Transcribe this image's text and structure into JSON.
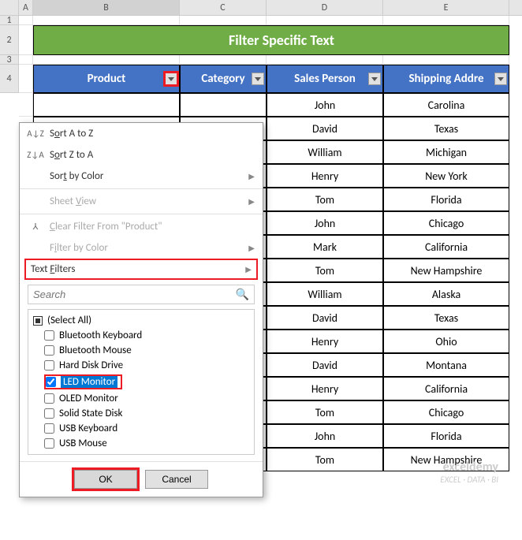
{
  "columns": [
    "A",
    "B",
    "C",
    "D",
    "E"
  ],
  "row_numbers": [
    "1",
    "2",
    "3",
    "4"
  ],
  "title": "Filter Specific Text",
  "headers": {
    "product": "Product",
    "category": "Category",
    "sales_person": "Sales Person",
    "shipping_address": "Shipping Addre"
  },
  "data_rows": [
    {
      "sales_person": "John",
      "shipping_address": "Carolina"
    },
    {
      "sales_person": "David",
      "shipping_address": "Texas"
    },
    {
      "sales_person": "William",
      "shipping_address": "Michigan"
    },
    {
      "sales_person": "Henry",
      "shipping_address": "New York"
    },
    {
      "sales_person": "Tom",
      "shipping_address": "Florida"
    },
    {
      "sales_person": "John",
      "shipping_address": "Chicago"
    },
    {
      "sales_person": "Mark",
      "shipping_address": "California"
    },
    {
      "sales_person": "Tom",
      "shipping_address": "New Hampshire"
    },
    {
      "sales_person": "William",
      "shipping_address": "Alaska"
    },
    {
      "sales_person": "David",
      "shipping_address": "Texas"
    },
    {
      "sales_person": "Henry",
      "shipping_address": "Ohio"
    },
    {
      "sales_person": "David",
      "shipping_address": "Montana"
    },
    {
      "sales_person": "Henry",
      "shipping_address": "California"
    },
    {
      "sales_person": "Tom",
      "shipping_address": "Chicago"
    },
    {
      "sales_person": "John",
      "shipping_address": "Florida"
    },
    {
      "sales_person": "Tom",
      "shipping_address": "New Hampshire"
    }
  ],
  "filter_menu": {
    "sort_az": "Sort A to Z",
    "sort_za": "Sort Z to A",
    "sort_by_color": "Sort by Color",
    "sheet_view": "Sheet View",
    "clear_filter": "Clear Filter From \"Product\"",
    "filter_by_color": "Filter by Color",
    "text_filters": "Text Filters",
    "search_placeholder": "Search",
    "items": {
      "select_all": "(Select All)",
      "bluetooth_keyboard": "Bluetooth Keyboard",
      "bluetooth_mouse": "Bluetooth Mouse",
      "hard_disk_drive": "Hard Disk Drive",
      "led_monitor": "LED Monitor",
      "oled_monitor": "OLED Monitor",
      "solid_state_disk": "Solid State Disk",
      "usb_keyboard": "USB Keyboard",
      "usb_mouse": "USB Mouse"
    },
    "ok": "OK",
    "cancel": "Cancel"
  },
  "watermark": {
    "main": "exceldemy",
    "sub": "EXCEL · DATA · BI"
  }
}
